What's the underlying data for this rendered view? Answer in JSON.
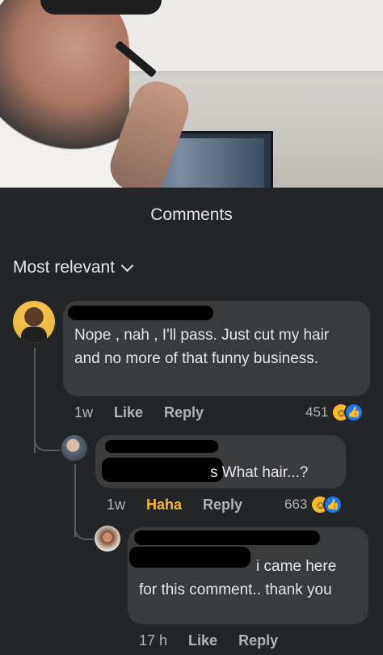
{
  "sheet": {
    "title": "Comments",
    "sort_label": "Most relevant"
  },
  "comments": [
    {
      "text": "Nope , nah , I'll pass. Just cut my hair and no more of that funny business.",
      "time": "1w",
      "like": "Like",
      "reply": "Reply",
      "reaction_count": "451",
      "reactions": [
        "laugh-icon",
        "like-icon"
      ]
    },
    {
      "text": "s What hair...?",
      "time": "1w",
      "like": "Haha",
      "reply": "Reply",
      "reaction_count": "663",
      "reactions": [
        "laugh-icon",
        "like-icon"
      ]
    },
    {
      "text": "i came here for this comment.. thank you",
      "time": "17 h",
      "like": "Like",
      "reply": "Reply"
    }
  ],
  "colors": {
    "background": "#242526",
    "bubble": "#3a3b3c",
    "haha": "#f7b928",
    "like_blue": "#1877f2"
  }
}
